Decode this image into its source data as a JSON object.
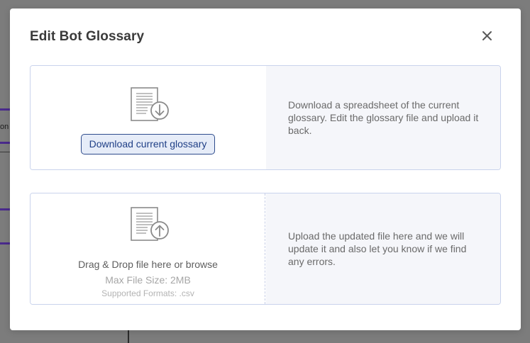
{
  "background": {
    "partial_text": "on"
  },
  "modal": {
    "title": "Edit Bot Glossary",
    "close_icon": "close-icon"
  },
  "download_card": {
    "icon": "document-download-icon",
    "button_label": "Download current glossary",
    "description": "Download a spreadsheet of the current glossary. Edit the glossary file and upload it back."
  },
  "upload_card": {
    "icon": "document-upload-icon",
    "drop_text": "Drag & Drop file here or browse",
    "max_size": "Max File Size: 2MB",
    "formats": "Supported Formats: .csv",
    "description": "Upload the updated file here and we will update it and also let you know if we find any errors."
  },
  "colors": {
    "accent": "#1f3f86",
    "accent_bg": "#e6ecf8",
    "card_border": "#c9d3ec",
    "panel_bg": "#f5f6fa",
    "backdrop": "#7c7c7c",
    "background_purple": "#4a2a8c"
  }
}
